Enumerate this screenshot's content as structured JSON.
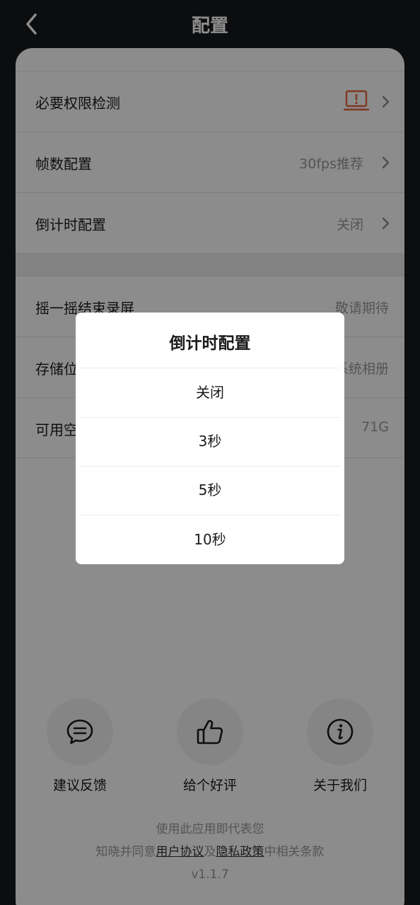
{
  "header": {
    "title": "配置"
  },
  "settings": {
    "rows": [
      {
        "label": "必要权限检测",
        "value": ""
      },
      {
        "label": "帧数配置",
        "value": "30fps推荐"
      },
      {
        "label": "倒计时配置",
        "value": "关闭"
      },
      {
        "label": "摇一摇结束录屏",
        "value": "敬请期待"
      },
      {
        "label": "存储位置",
        "value": "系统相册"
      },
      {
        "label": "可用空间",
        "value": "71G"
      }
    ]
  },
  "actions": [
    {
      "label": "建议反馈",
      "icon": "chat-bubble-icon"
    },
    {
      "label": "给个好评",
      "icon": "thumbs-up-icon"
    },
    {
      "label": "关于我们",
      "icon": "info-icon"
    }
  ],
  "legal": {
    "line1": "使用此应用即代表您",
    "line2_prefix": "知晓并同意",
    "user_agreement": "用户协议",
    "and": "及",
    "privacy_policy": "隐私政策",
    "line2_suffix": "中相关条款",
    "version": "v1.1.7"
  },
  "dialog": {
    "title": "倒计时配置",
    "options": [
      "关闭",
      "3秒",
      "5秒",
      "10秒"
    ]
  },
  "colors": {
    "accent_warning": "#e8663d",
    "overlay": "rgba(0,0,0,0.45)"
  }
}
